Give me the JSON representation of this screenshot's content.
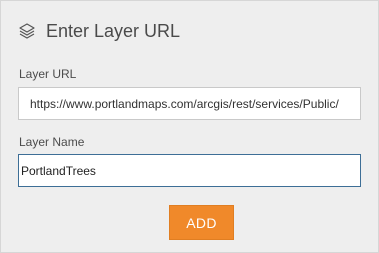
{
  "dialog": {
    "title": "Enter Layer URL",
    "icon": "layers-icon"
  },
  "layer_url": {
    "label": "Layer URL",
    "value": "https://www.portlandmaps.com/arcgis/rest/services/Public/"
  },
  "layer_name": {
    "label": "Layer Name",
    "value": "PortlandTrees"
  },
  "actions": {
    "add_label": "ADD"
  },
  "colors": {
    "panel_background": "#eeeeee",
    "accent_button": "#f0892a",
    "focus_border": "#3d6e96"
  }
}
